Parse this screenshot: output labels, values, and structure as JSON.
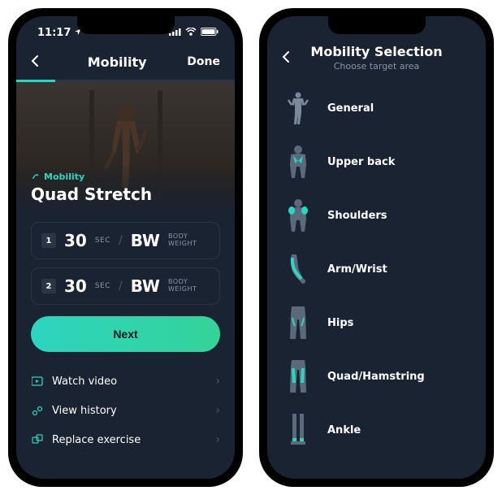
{
  "status": {
    "time": "11:17"
  },
  "screen1": {
    "nav": {
      "title": "Mobility",
      "done": "Done"
    },
    "category": "Mobility",
    "exercise_name": "Quad Stretch",
    "sets": [
      {
        "num": "1",
        "duration": "30",
        "unit": "SEC",
        "weight": "BW",
        "weight_label1": "BODY",
        "weight_label2": "WEIGHT"
      },
      {
        "num": "2",
        "duration": "30",
        "unit": "SEC",
        "weight": "BW",
        "weight_label1": "BODY",
        "weight_label2": "WEIGHT"
      }
    ],
    "next_label": "Next",
    "actions": {
      "watch": "Watch video",
      "history": "View history",
      "replace": "Replace exercise"
    }
  },
  "screen2": {
    "nav": {
      "title": "Mobility Selection",
      "subtitle": "Choose target area"
    },
    "items": {
      "general": "General",
      "upperback": "Upper back",
      "shoulders": "Shoulders",
      "armwrist": "Arm/Wrist",
      "hips": "Hips",
      "quadham": "Quad/Hamstring",
      "ankle": "Ankle"
    }
  }
}
